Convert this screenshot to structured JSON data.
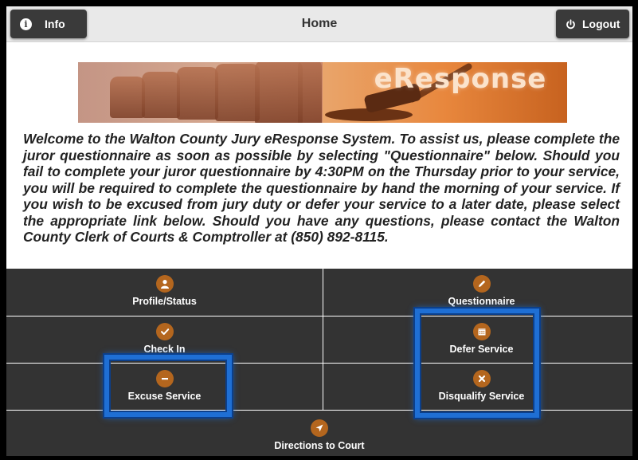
{
  "header": {
    "title": "Home",
    "info_label": "Info",
    "logout_label": "Logout"
  },
  "banner": {
    "text": "eResponse"
  },
  "welcome_text": "Welcome to the Walton County Jury eResponse System. To assist us, please complete the juror questionnaire as soon as possible by selecting \"Questionnaire\" below. Should you fail to complete your juror questionnaire by 4:30PM on the Thursday prior to your service, you will be required to complete the questionnaire by hand the morning of your service. If you wish to be excused from jury duty or defer your service to a later date, please select the appropriate link below. Should you have any questions, please contact the Walton County Clerk of Courts & Comptroller at (850) 892-8115.",
  "menu": {
    "profile": "Profile/Status",
    "questionnaire": "Questionnaire",
    "check_in": "Check In",
    "defer": "Defer Service",
    "excuse": "Excuse Service",
    "disqualify": "Disqualify Service",
    "directions": "Directions to Court"
  },
  "colors": {
    "menu_bg": "#333333",
    "icon_bg": "#b4661e",
    "highlight": "#1f6fd4"
  }
}
